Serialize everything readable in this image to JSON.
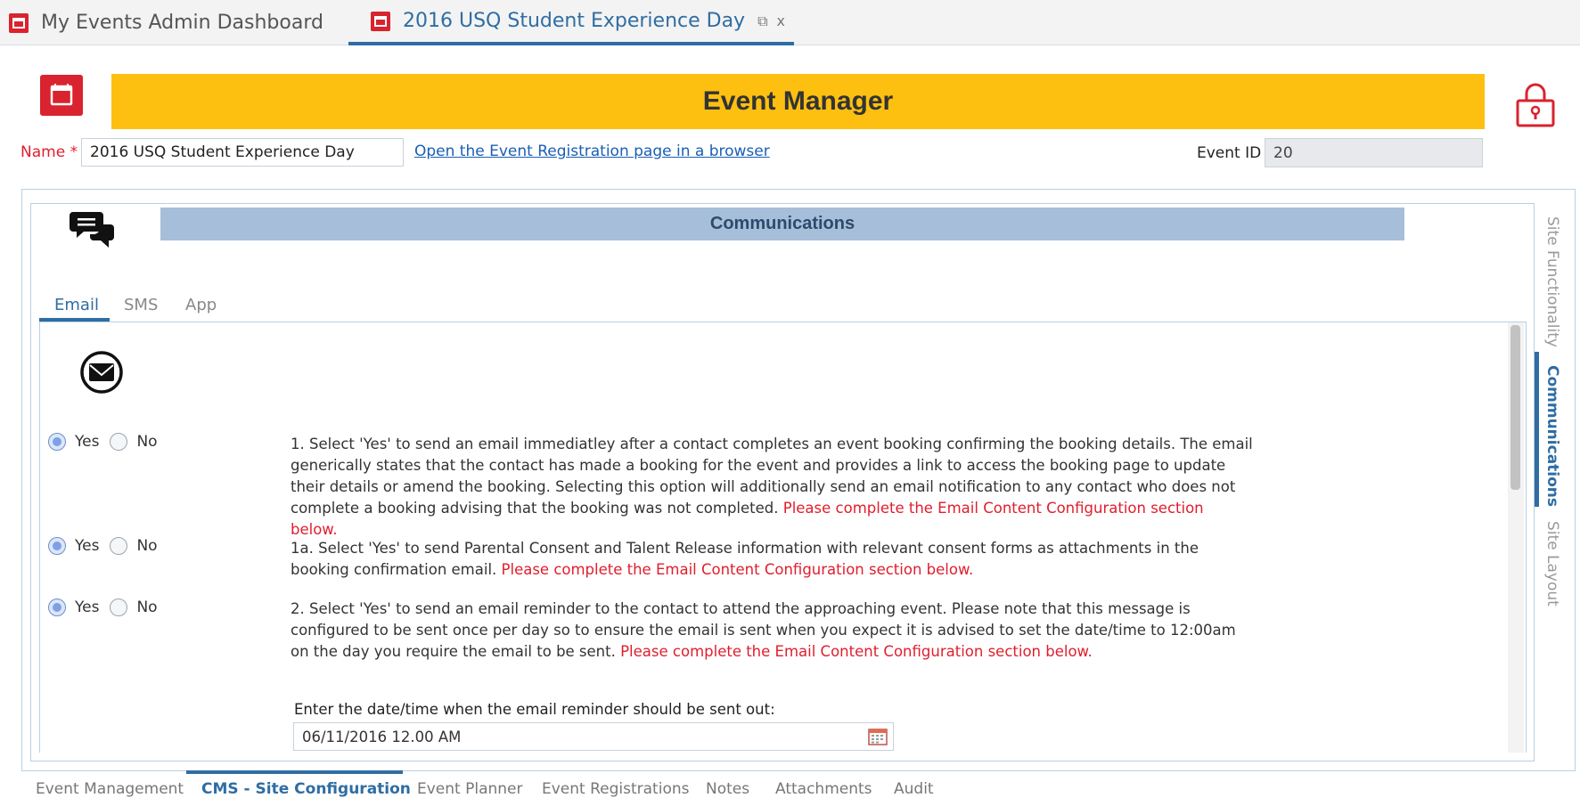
{
  "doc_tabs": [
    {
      "label": "My Events Admin Dashboard",
      "active": false
    },
    {
      "label": "2016 USQ Student Experience Day",
      "active": true
    }
  ],
  "doc_tab_controls": {
    "restore": "⧉",
    "close": "x"
  },
  "header": {
    "title": "Event Manager"
  },
  "form": {
    "name_label": "Name",
    "name_required": "*",
    "name_value": "2016 USQ Student Experience Day",
    "open_link": "Open the Event Registration page in a browser",
    "event_id_label": "Event ID",
    "event_id_value": "20"
  },
  "section": {
    "title": "Communications"
  },
  "sub_tabs": [
    {
      "label": "Email",
      "active": true
    },
    {
      "label": "SMS",
      "active": false
    },
    {
      "label": "App",
      "active": false
    }
  ],
  "options": [
    {
      "yes_label": "Yes",
      "no_label": "No",
      "selected": "Yes",
      "text": "1. Select 'Yes' to send an email immediatley after a contact completes an event booking confirming the booking details. The email generically states that the contact has made a booking for the event and provides a link to access the booking page to update their details or amend the booking. Selecting this option will additionally send an email notification to any contact who does not complete a booking advising that the booking was not completed.",
      "warning": "Please complete the Email Content Configuration section below."
    },
    {
      "yes_label": "Yes",
      "no_label": "No",
      "selected": "Yes",
      "text": "1a. Select 'Yes' to send Parental Consent and Talent Release information with relevant consent forms as attachments in the booking confirmation email.",
      "warning": "Please complete the Email Content Configuration section below."
    },
    {
      "yes_label": "Yes",
      "no_label": "No",
      "selected": "Yes",
      "text": "2. Select 'Yes' to send an email reminder to the contact to attend the approaching event. Please note that this message is configured to be sent once per day so to ensure the email is sent when you expect it is advised to set the date/time to 12:00am on the day you require the email to be sent.",
      "warning": "Please complete the Email Content Configuration section below."
    }
  ],
  "reminder": {
    "label": "Enter the date/time when the email reminder should be sent out:",
    "value": "06/11/2016 12.00 AM"
  },
  "side_tabs": [
    {
      "label": "Site Functionality",
      "active": false
    },
    {
      "label": "Communications",
      "active": true
    },
    {
      "label": "Site Layout",
      "active": false
    }
  ],
  "bottom_tabs": [
    {
      "label": "Event Management",
      "active": false
    },
    {
      "label": "CMS - Site Configuration",
      "active": true
    },
    {
      "label": "Event Planner",
      "active": false
    },
    {
      "label": "Event Registrations",
      "active": false
    },
    {
      "label": "Notes",
      "active": false
    },
    {
      "label": "Attachments",
      "active": false
    },
    {
      "label": "Audit",
      "active": false
    }
  ],
  "colors": {
    "accent": "#2f6da3",
    "title_bar": "#fdc011",
    "section_bar": "#a7bedb",
    "warning": "#e01e2d",
    "calendar_red": "#d9232e"
  },
  "icons": [
    "calendar-icon",
    "lock-icon",
    "chat-bubbles-icon",
    "envelope-icon",
    "date-picker-icon"
  ]
}
